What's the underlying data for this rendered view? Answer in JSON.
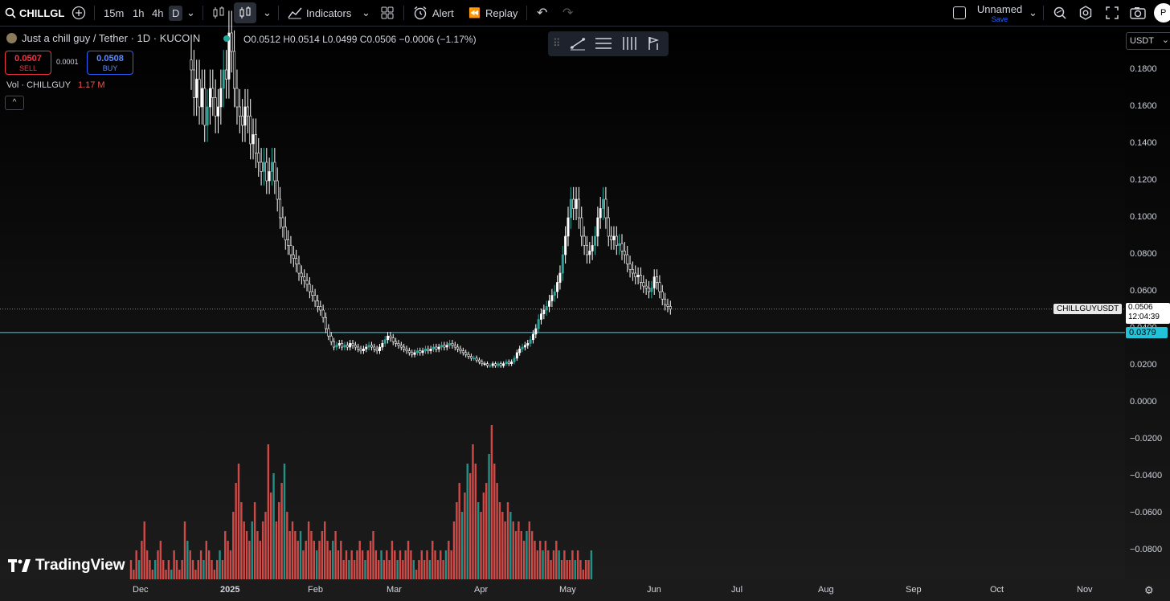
{
  "toolbar": {
    "symbol": "CHILLGL",
    "timeframes": [
      "15m",
      "1h",
      "4h",
      "D"
    ],
    "active_timeframe": "D",
    "indicators_label": "Indicators",
    "alert_label": "Alert",
    "replay_label": "Replay",
    "layout_name": "Unnamed",
    "layout_save": "Save",
    "profile_initial": "P"
  },
  "legend": {
    "title": "Just a chill guy / Tether · 1D · KUCOIN",
    "ohlc": "O0.0512 H0.0514 L0.0499 C0.0506 −0.0006 (−1.17%)",
    "sell_price": "0.0507",
    "sell_label": "SELL",
    "spread": "0.0001",
    "buy_price": "0.0508",
    "buy_label": "BUY",
    "vol_label": "Vol · CHILLGUY",
    "vol_value": "1.17 M",
    "collapse_glyph": "^"
  },
  "price_axis": {
    "currency": "USDT",
    "ticks": [
      "0.1800",
      "0.1600",
      "0.1400",
      "0.1200",
      "0.1000",
      "0.0800",
      "0.0600",
      "0.0400",
      "0.0200",
      "0.0000",
      "−0.0200",
      "−0.0400",
      "−0.0600",
      "−0.0800"
    ],
    "current_symbol": "CHILLGUYUSDT",
    "current_price": "0.0506",
    "countdown": "12:04:39",
    "hline_price": "0.0379"
  },
  "time_axis": {
    "labels": [
      "Dec",
      "2025",
      "Feb",
      "Mar",
      "Apr",
      "May",
      "Jun",
      "Jul",
      "Aug",
      "Sep",
      "Oct",
      "Nov"
    ]
  },
  "brand": {
    "name": "TradingView"
  },
  "colors": {
    "up": "#26a69a",
    "down": "#ef5350",
    "hline": "#22c3d8",
    "candle_up": "#ffffff",
    "candle_up_alt": "#26a69a"
  },
  "chart_data": {
    "type": "candlestick",
    "title": "Just a chill guy / Tether · 1D · KUCOIN",
    "ylim": [
      -0.09,
      0.2
    ],
    "y_ticks": [
      0.18,
      0.16,
      0.14,
      0.12,
      0.1,
      0.08,
      0.06,
      0.04,
      0.02,
      0.0,
      -0.02,
      -0.04,
      -0.06,
      -0.08
    ],
    "x_labels": [
      "Dec",
      "2025",
      "Feb",
      "Mar",
      "Apr",
      "May",
      "Jun",
      "Jul",
      "Aug",
      "Sep",
      "Oct",
      "Nov"
    ],
    "last_close": 0.0506,
    "horizontal_line": 0.0379,
    "close_series": {
      "start": "2024-11-25",
      "interval": "1d",
      "values": [
        0.18,
        0.165,
        0.175,
        0.16,
        0.17,
        0.15,
        0.16,
        0.17,
        0.165,
        0.155,
        0.16,
        0.17,
        0.18,
        0.175,
        0.2,
        0.19,
        0.17,
        0.16,
        0.155,
        0.15,
        0.16,
        0.155,
        0.14,
        0.145,
        0.135,
        0.13,
        0.125,
        0.13,
        0.12,
        0.125,
        0.13,
        0.12,
        0.11,
        0.1,
        0.095,
        0.088,
        0.085,
        0.08,
        0.078,
        0.075,
        0.07,
        0.068,
        0.066,
        0.064,
        0.06,
        0.058,
        0.055,
        0.052,
        0.05,
        0.046,
        0.04,
        0.036,
        0.033,
        0.03,
        0.031,
        0.032,
        0.03,
        0.031,
        0.03,
        0.032,
        0.031,
        0.03,
        0.029,
        0.028,
        0.029,
        0.03,
        0.031,
        0.03,
        0.029,
        0.028,
        0.03,
        0.032,
        0.034,
        0.036,
        0.035,
        0.033,
        0.032,
        0.031,
        0.03,
        0.029,
        0.028,
        0.027,
        0.026,
        0.027,
        0.028,
        0.027,
        0.028,
        0.029,
        0.028,
        0.029,
        0.03,
        0.029,
        0.03,
        0.031,
        0.03,
        0.031,
        0.032,
        0.031,
        0.03,
        0.029,
        0.028,
        0.027,
        0.026,
        0.025,
        0.024,
        0.024,
        0.023,
        0.022,
        0.021,
        0.021,
        0.02,
        0.02,
        0.021,
        0.02,
        0.021,
        0.02,
        0.021,
        0.022,
        0.021,
        0.022,
        0.024,
        0.027,
        0.029,
        0.03,
        0.031,
        0.032,
        0.034,
        0.037,
        0.04,
        0.045,
        0.048,
        0.05,
        0.052,
        0.055,
        0.058,
        0.06,
        0.065,
        0.07,
        0.08,
        0.09,
        0.1,
        0.11,
        0.105,
        0.11,
        0.1,
        0.09,
        0.085,
        0.08,
        0.082,
        0.085,
        0.09,
        0.1,
        0.105,
        0.11,
        0.1,
        0.09,
        0.088,
        0.09,
        0.085,
        0.086,
        0.082,
        0.08,
        0.075,
        0.072,
        0.07,
        0.068,
        0.069,
        0.065,
        0.063,
        0.062,
        0.06,
        0.062,
        0.068,
        0.065,
        0.06,
        0.056,
        0.053,
        0.052,
        0.0506
      ]
    },
    "volume_series_millions": [
      2,
      1,
      3,
      2,
      4,
      6,
      3,
      2,
      1,
      2,
      3,
      4,
      2,
      1,
      2,
      1,
      3,
      2,
      1,
      2,
      6,
      4,
      3,
      2,
      1,
      2,
      3,
      2,
      4,
      3,
      2,
      1,
      2,
      3,
      2,
      5,
      4,
      3,
      7,
      10,
      12,
      8,
      6,
      5,
      4,
      6,
      8,
      5,
      4,
      6,
      7,
      14,
      9,
      11,
      6,
      8,
      10,
      12,
      7,
      5,
      6,
      5,
      4,
      5,
      3,
      4,
      6,
      5,
      4,
      3,
      4,
      5,
      6,
      4,
      3,
      4,
      5,
      3,
      4,
      2,
      3,
      2,
      3,
      2,
      3,
      4,
      3,
      2,
      3,
      4,
      5,
      3,
      2,
      3,
      2,
      3,
      2,
      4,
      3,
      2,
      3,
      2,
      3,
      4,
      3,
      2,
      1,
      2,
      3,
      2,
      3,
      2,
      4,
      3,
      2,
      3,
      2,
      3,
      4,
      3,
      6,
      8,
      10,
      7,
      9,
      12,
      11,
      14,
      12,
      8,
      7,
      9,
      10,
      13,
      16,
      12,
      10,
      8,
      7,
      6,
      8,
      7,
      6,
      5,
      6,
      5,
      4,
      5,
      6,
      5,
      4,
      3,
      4,
      3,
      4,
      3,
      2,
      3,
      4,
      3,
      2,
      3,
      2,
      2,
      3,
      2,
      3,
      2,
      1,
      2,
      2,
      3
    ]
  }
}
